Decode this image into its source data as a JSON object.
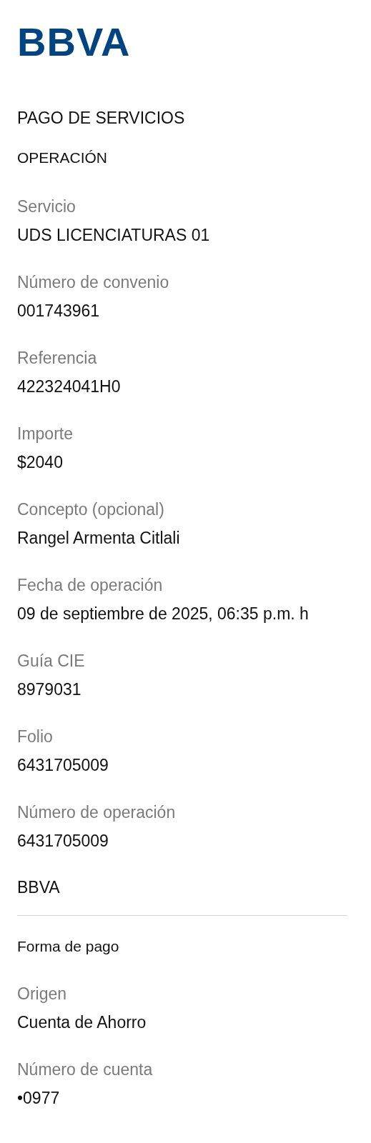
{
  "logo": "BBVA",
  "title": "PAGO DE SERVICIOS",
  "section": "OPERACIÓN",
  "fields": [
    {
      "label": "Servicio",
      "value": "UDS LICENCIATURAS 01"
    },
    {
      "label": "Número de convenio",
      "value": "001743961"
    },
    {
      "label": "Referencia",
      "value": "422324041H0"
    },
    {
      "label": "Importe",
      "value": "$2040"
    },
    {
      "label": "Concepto (opcional)",
      "value": "Rangel Armenta Citlali"
    },
    {
      "label": "Fecha de operación",
      "value": "09 de septiembre de 2025, 06:35 p.m. h"
    },
    {
      "label": "Guía CIE",
      "value": "8979031"
    },
    {
      "label": "Folio",
      "value": "6431705009"
    },
    {
      "label": "Número de operación",
      "value": "6431705009"
    }
  ],
  "bank": "BBVA",
  "payment": {
    "title": "Forma de pago",
    "fields": [
      {
        "label": "Origen",
        "value": "Cuenta de Ahorro"
      },
      {
        "label": "Número de cuenta",
        "value": "•0977"
      }
    ]
  }
}
